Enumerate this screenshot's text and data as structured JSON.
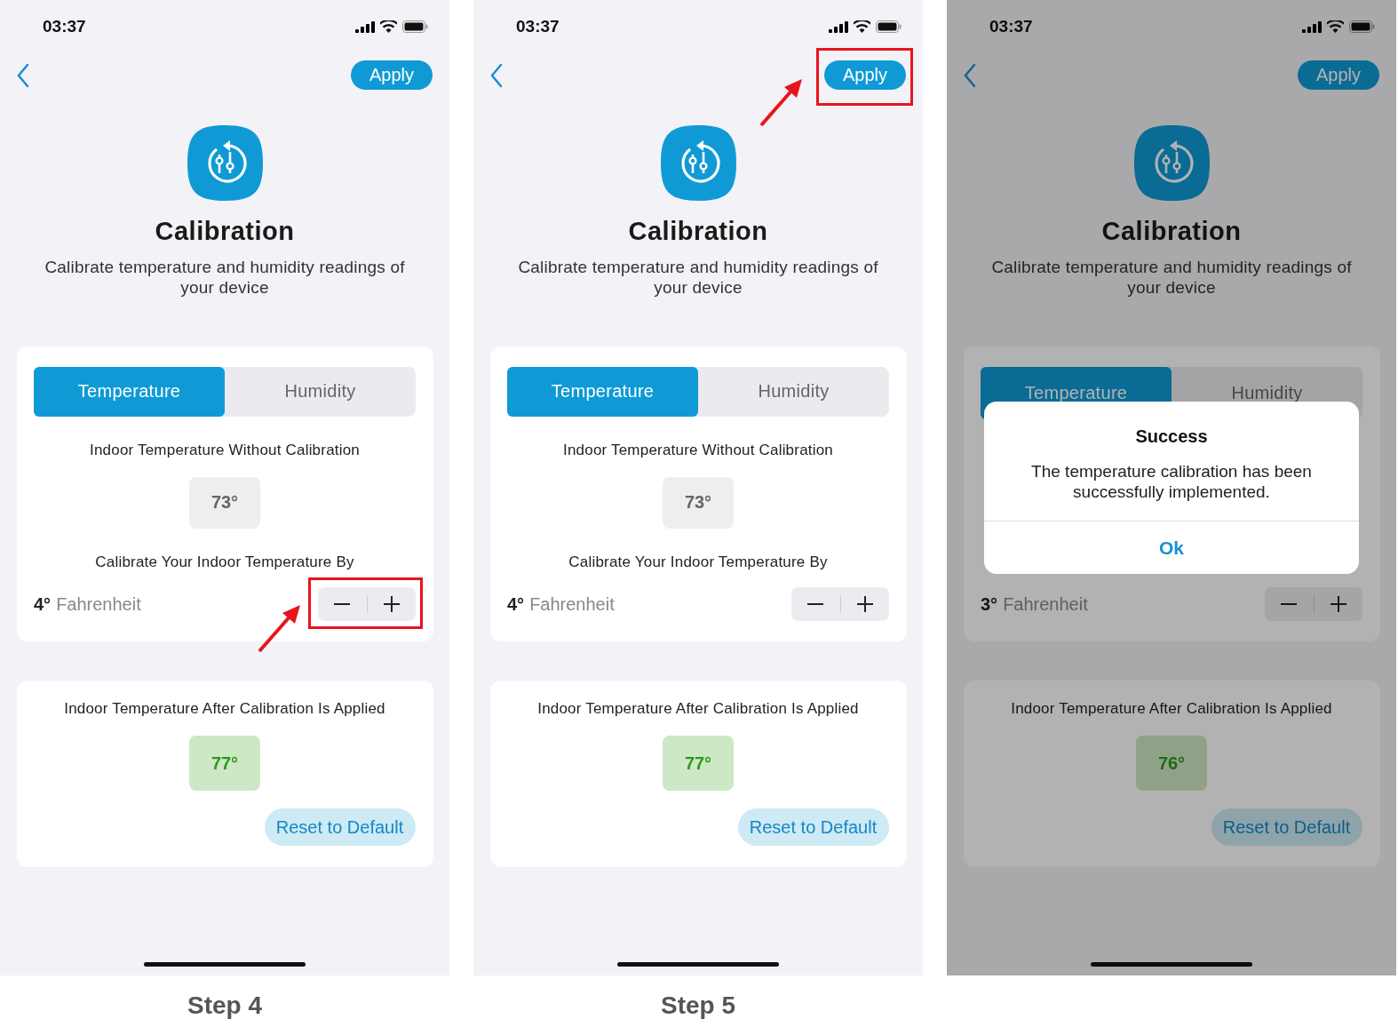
{
  "screens": [
    {
      "status_time": "03:37",
      "apply_label": "Apply",
      "title": "Calibration",
      "subtitle": "Calibrate temperature and humidity readings of your device",
      "tabs": [
        {
          "label": "Temperature",
          "selected": true
        },
        {
          "label": "Humidity",
          "selected": false
        }
      ],
      "uncalibrated_label": "Indoor Temperature Without Calibration",
      "uncalibrated_value": "73°",
      "offset_label": "Calibrate Your Indoor Temperature By",
      "offset_value": "4°",
      "offset_unit": "Fahrenheit",
      "result_label": "Indoor Temperature After Calibration Is Applied",
      "result_value": "77°",
      "reset_label": "Reset to Default",
      "stepper_highlighted": true,
      "apply_highlighted": false,
      "caption": "Step 4"
    },
    {
      "status_time": "03:37",
      "apply_label": "Apply",
      "title": "Calibration",
      "subtitle": "Calibrate temperature and humidity readings of your device",
      "tabs": [
        {
          "label": "Temperature",
          "selected": true
        },
        {
          "label": "Humidity",
          "selected": false
        }
      ],
      "uncalibrated_label": "Indoor Temperature Without Calibration",
      "uncalibrated_value": "73°",
      "offset_label": "Calibrate Your Indoor Temperature By",
      "offset_value": "4°",
      "offset_unit": "Fahrenheit",
      "result_label": "Indoor Temperature After Calibration Is Applied",
      "result_value": "77°",
      "reset_label": "Reset to Default",
      "stepper_highlighted": false,
      "apply_highlighted": true,
      "caption": "Step 5"
    },
    {
      "status_time": "03:37",
      "apply_label": "Apply",
      "title": "Calibration",
      "subtitle": "Calibrate temperature and humidity readings of your device",
      "tabs": [
        {
          "label": "Temperature",
          "selected": true
        },
        {
          "label": "Humidity",
          "selected": false
        }
      ],
      "offset_value": "3°",
      "offset_unit": "Fahrenheit",
      "result_label": "Indoor Temperature After Calibration Is Applied",
      "result_value": "76°",
      "reset_label": "Reset to Default",
      "dialog": {
        "title": "Success",
        "message": "The temperature calibration has been successfully implemented.",
        "button": "Ok"
      }
    }
  ]
}
